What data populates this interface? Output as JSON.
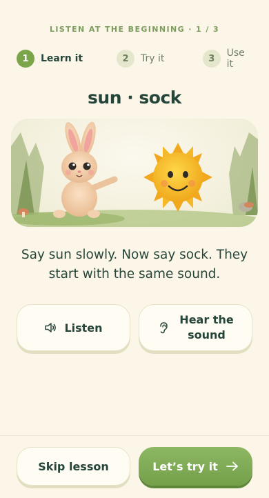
{
  "header": {
    "progress_label": "LISTEN AT THE BEGINNING · 1 / 3"
  },
  "steps": [
    {
      "number": "1",
      "label": "Learn it",
      "state": "active"
    },
    {
      "number": "2",
      "label": "Try it",
      "state": "upcoming"
    },
    {
      "number": "3",
      "label": "Use it",
      "state": "upcoming"
    }
  ],
  "lesson": {
    "title": "sun · sock",
    "illustration": {
      "left": "bunny",
      "right": "sun"
    },
    "instruction": "Say sun slowly. Now say sock. They start with the same sound."
  },
  "actions": {
    "listen_label": "Listen",
    "listen_icon": "speaker-icon",
    "hear_label": "Hear the sound",
    "hear_icon": "ear-icon"
  },
  "footer": {
    "skip_label": "Skip lesson",
    "next_label": "Let’s try it",
    "next_icon": "arrow-right-icon"
  },
  "colors": {
    "background": "#fcf6e8",
    "accent": "#7aa54b",
    "text": "#26453a",
    "muted": "#7c9c5d"
  }
}
